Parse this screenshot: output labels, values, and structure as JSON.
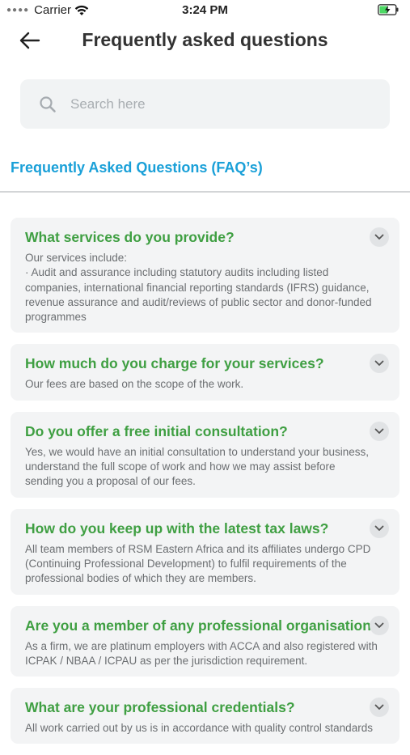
{
  "status_bar": {
    "carrier": "Carrier",
    "time": "3:24 PM"
  },
  "header": {
    "title": "Frequently asked questions"
  },
  "search": {
    "placeholder": "Search here"
  },
  "section": {
    "heading": "Frequently Asked Questions (FAQ’s)"
  },
  "colors": {
    "question_green": "#3f9f42",
    "heading_blue": "#1aa0d8",
    "card_bg": "#f3f4f5"
  },
  "faqs": [
    {
      "question": "What services do you provide?",
      "answer_lines": [
        "Our services include:",
        "·        Audit and assurance including statutory audits including listed",
        "companies, international financial reporting standards (IFRS) guidance,",
        "revenue assurance and audit/reviews of public sector and donor-funded",
        "programmes"
      ]
    },
    {
      "question": "How much do you charge for your services?",
      "answer_lines": [
        "Our fees are based on the scope of the work."
      ]
    },
    {
      "question": "Do you offer a free initial consultation?",
      "answer_lines": [
        "Yes, we would have an initial consultation to understand your business,",
        "understand the full scope of work and how we may assist before",
        "sending you a proposal of our fees."
      ]
    },
    {
      "question": "How do you keep up with the latest tax laws?",
      "answer_lines": [
        "All team members of RSM Eastern Africa and its affiliates undergo CPD",
        "(Continuing Professional Development) to fulfil requirements of the",
        "professional bodies of which they are members."
      ]
    },
    {
      "question": "Are you a member of any professional organisations?",
      "answer_lines": [
        "As a firm, we are platinum employers with ACCA and also registered with",
        "ICPAK / NBAA / ICPAU as per the jurisdiction requirement."
      ]
    },
    {
      "question": "What are your professional credentials?",
      "answer_lines": [
        "All work carried out by us is in accordance with quality control standards"
      ]
    }
  ]
}
